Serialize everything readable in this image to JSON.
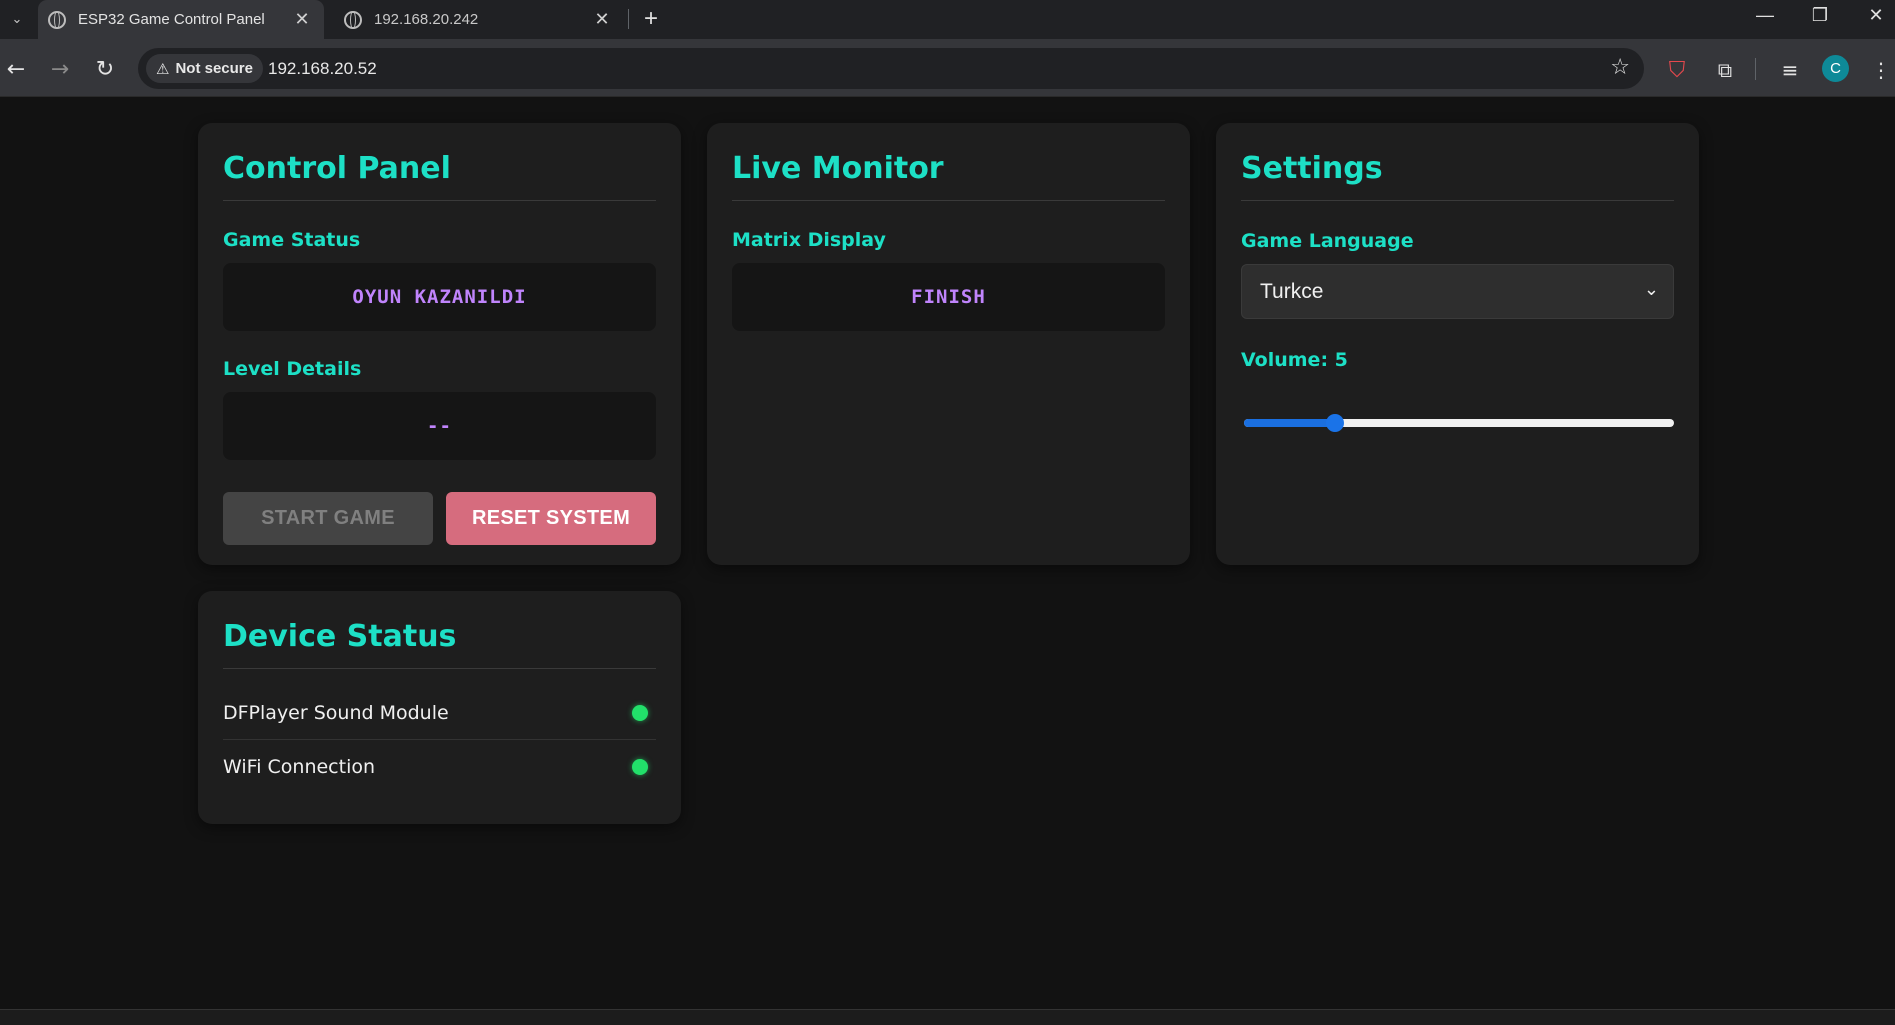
{
  "browser": {
    "tabs": [
      {
        "title": "ESP32 Game Control Panel",
        "active": true
      },
      {
        "title": "192.168.20.242",
        "active": false
      }
    ],
    "security_label": "Not secure",
    "url": "192.168.20.52",
    "icons": {
      "tab_menu": "chevron-down-icon",
      "back": "back-arrow-icon",
      "forward": "forward-arrow-icon",
      "reload": "reload-icon",
      "bookmark": "star-icon",
      "extension": "puzzle-icon",
      "media": "media-control-icon",
      "more": "kebab-menu-icon"
    },
    "profile_initial": "C"
  },
  "control_panel": {
    "title": "Control Panel",
    "game_status_label": "Game Status",
    "game_status_value": "OYUN KAZANILDI",
    "level_details_label": "Level Details",
    "level_details_value": "--",
    "start_button": "START GAME",
    "reset_button": "RESET SYSTEM"
  },
  "live_monitor": {
    "title": "Live Monitor",
    "matrix_label": "Matrix Display",
    "matrix_value": "FINISH"
  },
  "settings": {
    "title": "Settings",
    "language_label": "Game Language",
    "language_value": "Turkce",
    "volume_label": "Volume: 5",
    "volume": 5,
    "volume_max": 25
  },
  "device_status": {
    "title": "Device Status",
    "devices": [
      {
        "name": "DFPlayer Sound Module",
        "status": "online"
      },
      {
        "name": "WiFi Connection",
        "status": "online"
      }
    ]
  },
  "colors": {
    "accent": "#1de0c6",
    "display_text": "#c084fc",
    "reset_button": "#d66c7e",
    "status_online": "#22e06a",
    "slider": "#1a73e8"
  }
}
